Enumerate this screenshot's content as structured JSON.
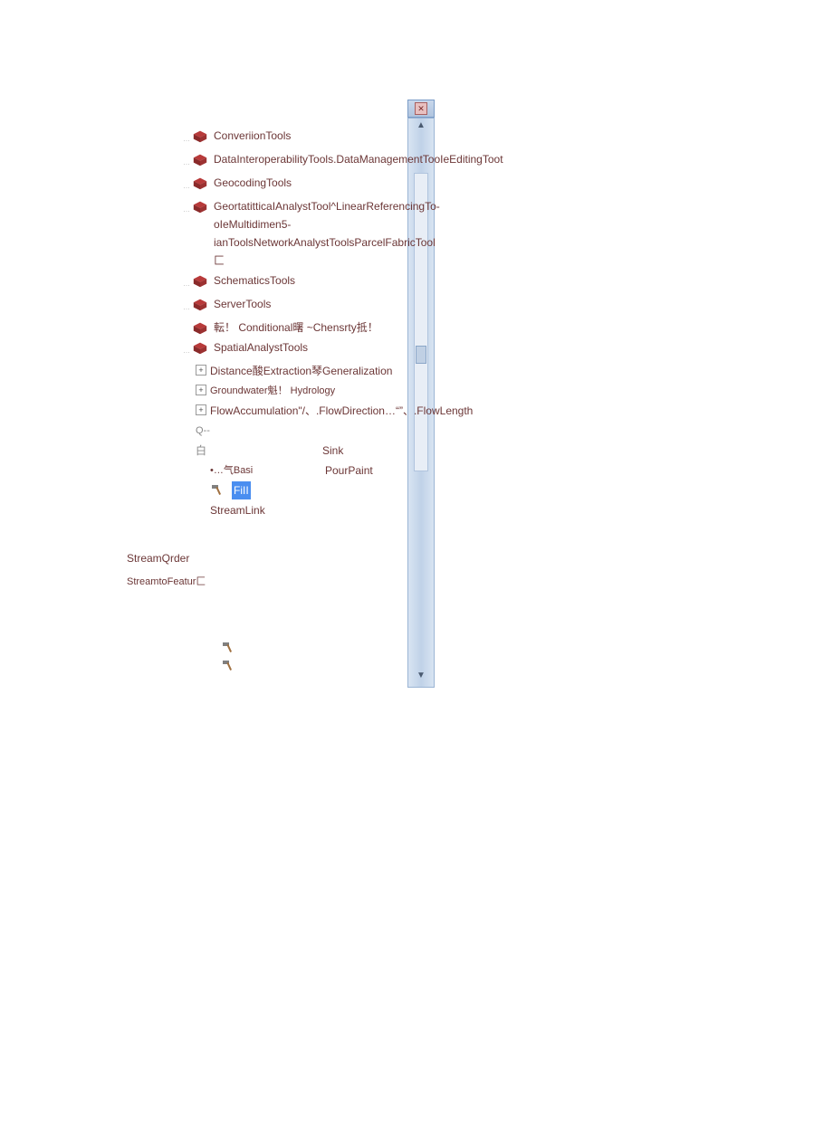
{
  "close_label": "✕",
  "scroll_up": "▲",
  "scroll_down": "▼",
  "toolboxes": [
    "ConveriionTools",
    "DataInteroperabilityTools.DataManagementTooIeEditingToot",
    "GeocodingTools",
    "GeortatitticaIAnalystTool^LinearReferencingTo-oIeMultidimen5-ianToolsNetworkAnalystToolsParcelFabricTool匚",
    "SchematicsTools",
    "ServerTools"
  ],
  "weird_line": "転！ Conditional曙 ~Chensrty抵！",
  "spatial": "SpatialAnalystTools",
  "sub1": "Distance酸Extraction琴Generalization",
  "sub2": "Groundwater魁！ Hydrology",
  "sub3": "FlowAccumulation\"/、.FlowDirection…“”、.FlowLength",
  "sink": "Sink",
  "pour": "PourPaint",
  "basi": "•…气Basi",
  "fill": "FiII",
  "streamlink": "StreamLink",
  "streamorder": "StreamQrder",
  "streamtofeature": "StreamtoFeatur匚",
  "white_char": "白",
  "q_char": "Q--"
}
